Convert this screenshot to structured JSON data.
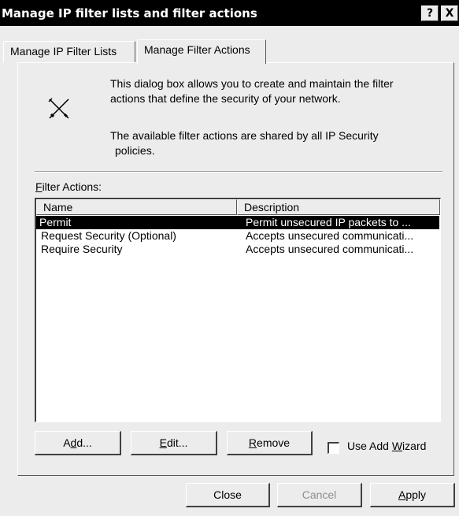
{
  "window": {
    "title": "Manage IP filter lists and filter actions",
    "help_button": "?",
    "close_button": "X"
  },
  "tabs": [
    {
      "label": "Manage IP Filter Lists",
      "active": false
    },
    {
      "label": "Manage Filter Actions",
      "active": true
    }
  ],
  "info": {
    "icon": "tools-icon",
    "line1": "This dialog box allows you to create and maintain the filter",
    "line2": "actions that define the security of your network.",
    "line3": "The available filter actions are shared by all IP Security",
    "line4": "policies."
  },
  "filter_actions": {
    "label_first": "F",
    "label_rest": "ilter Actions:",
    "columns": [
      "Name",
      "Description"
    ],
    "rows": [
      {
        "name": "Permit",
        "description": "Permit unsecured IP packets to ...",
        "selected": true
      },
      {
        "name": "Request Security (Optional)",
        "description": "Accepts unsecured communicati...",
        "selected": false
      },
      {
        "name": "Require Security",
        "description": "Accepts unsecured communicati...",
        "selected": false
      }
    ]
  },
  "buttons": {
    "add": {
      "pre": "A",
      "u": "d",
      "post": "d..."
    },
    "edit": {
      "pre": "",
      "u": "E",
      "post": "dit..."
    },
    "remove": {
      "pre": "",
      "u": "R",
      "post": "emove"
    },
    "wizard": {
      "pre": "Use Add ",
      "u": "W",
      "post": "izard",
      "checked": false
    }
  },
  "footer": {
    "close": "Close",
    "cancel": "Cancel",
    "apply_u": "A",
    "apply_rest": "pply"
  }
}
